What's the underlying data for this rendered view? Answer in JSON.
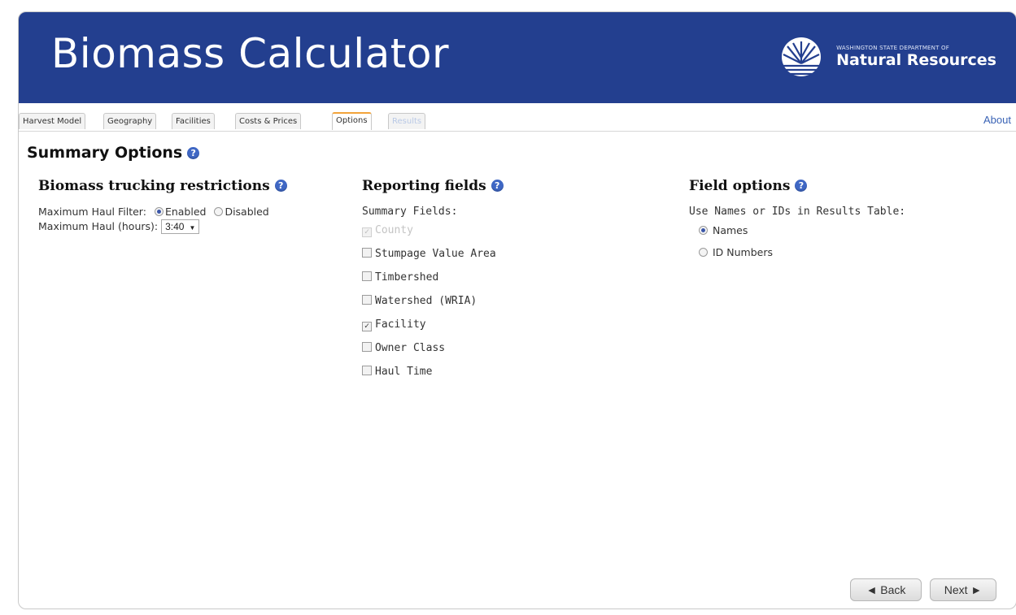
{
  "app": {
    "title": "Biomass Calculator",
    "org_line1": "WASHINGTON STATE DEPARTMENT OF",
    "org_line2": "Natural Resources",
    "brand_color": "#233f8f",
    "logo_icon": "dnr-tree-logo"
  },
  "tabs": [
    {
      "label": "Harvest Model",
      "state": "normal"
    },
    {
      "label": "Geography",
      "state": "normal"
    },
    {
      "label": "Facilities",
      "state": "normal"
    },
    {
      "label": "Costs & Prices",
      "state": "normal"
    },
    {
      "label": "Options",
      "state": "active"
    },
    {
      "label": "Results",
      "state": "disabled"
    }
  ],
  "about": "About",
  "page_title": "Summary Options",
  "help_icon": "?",
  "trucking": {
    "heading": "Biomass trucking restrictions",
    "filter_label": "Maximum Haul Filter:",
    "enabled_label": "Enabled",
    "disabled_label": "Disabled",
    "selected": "Enabled",
    "haul_label": "Maximum Haul (hours):",
    "haul_value": "3:40"
  },
  "reporting": {
    "heading": "Reporting fields",
    "summary_label": "Summary Fields:",
    "fields": [
      {
        "label": "County",
        "checked": true,
        "disabled": true
      },
      {
        "label": "Stumpage Value Area",
        "checked": false,
        "disabled": false
      },
      {
        "label": "Timbershed",
        "checked": false,
        "disabled": false
      },
      {
        "label": "Watershed (WRIA)",
        "checked": false,
        "disabled": false
      },
      {
        "label": "Facility",
        "checked": true,
        "disabled": false
      },
      {
        "label": "Owner Class",
        "checked": false,
        "disabled": false
      },
      {
        "label": "Haul Time",
        "checked": false,
        "disabled": false
      }
    ]
  },
  "field_options": {
    "heading": "Field options",
    "question": "Use Names or IDs in Results Table:",
    "names_label": "Names",
    "ids_label": "ID Numbers",
    "selected": "Names"
  },
  "nav": {
    "back_label": "◄ Back",
    "next_label": "Next ►"
  }
}
